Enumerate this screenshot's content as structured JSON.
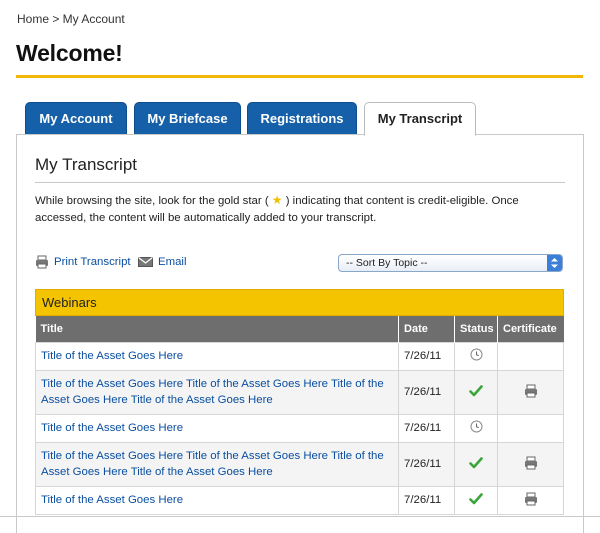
{
  "breadcrumb": "Home > My Account",
  "page_title": "Welcome!",
  "tabs": [
    {
      "label": "My Account",
      "active": false
    },
    {
      "label": "My Briefcase",
      "active": false
    },
    {
      "label": "Registrations",
      "active": false
    },
    {
      "label": "My Transcript",
      "active": true
    }
  ],
  "section_title": "My Transcript",
  "intro": {
    "before": "While browsing the site, look for the gold star ( ",
    "after": " ) indicating that content is credit-eligible. Once accessed, the content will be automatically added to your transcript."
  },
  "actions": {
    "print_label": "Print Transcript",
    "email_label": "Email"
  },
  "sort": {
    "selected": "-- Sort By Topic --"
  },
  "group": {
    "label": "Webinars"
  },
  "table": {
    "columns": [
      "Title",
      "Date",
      "Status",
      "Certificate"
    ],
    "rows": [
      {
        "title": "Title of the Asset Goes Here",
        "date": "7/26/11",
        "status": "pending",
        "certificate": false
      },
      {
        "title": "Title of the Asset Goes Here Title of the Asset Goes Here Title of the Asset Goes Here Title of the Asset Goes Here",
        "date": "7/26/11",
        "status": "complete",
        "certificate": true
      },
      {
        "title": "Title of the Asset Goes Here",
        "date": "7/26/11",
        "status": "pending",
        "certificate": false
      },
      {
        "title": "Title of the Asset Goes Here Title of the Asset Goes Here Title of the Asset Goes Here Title of the Asset Goes Here",
        "date": "7/26/11",
        "status": "complete",
        "certificate": true
      },
      {
        "title": "Title of the Asset Goes Here",
        "date": "7/26/11",
        "status": "complete",
        "certificate": true
      }
    ]
  },
  "colors": {
    "accent_yellow": "#f2b705",
    "tab_blue": "#1560a8",
    "link_blue": "#0b4fa0",
    "header_gray": "#6e6e6e",
    "check_green": "#3aa53a"
  },
  "icons": {
    "status_pending": "clock-icon",
    "status_complete": "checkmark-icon",
    "certificate": "printer-icon",
    "print": "printer-icon",
    "email": "envelope-icon",
    "star": "gold-star-icon"
  }
}
